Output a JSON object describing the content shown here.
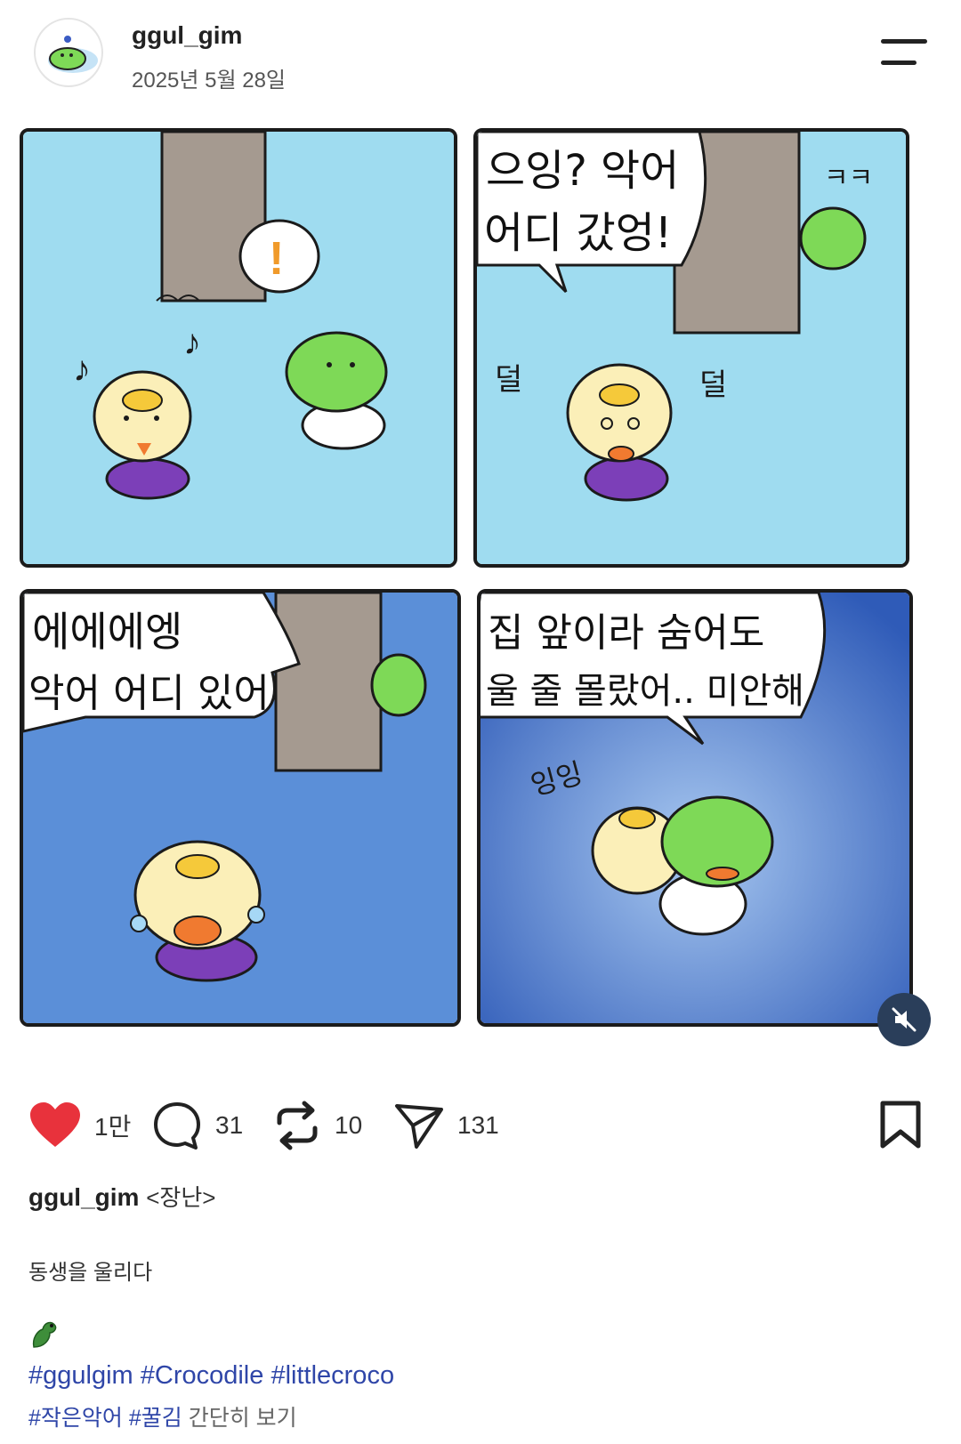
{
  "header": {
    "username": "ggul_gim",
    "date": "2025년 5월 28일"
  },
  "comic": {
    "panel1": {
      "bubble": "!"
    },
    "panel2": {
      "bubble_line1": "으잉? 악어",
      "bubble_line2": "어디 갔엉!",
      "sfx_giggle": "ㅋㅋ",
      "sfx_left": "덜",
      "sfx_right": "덜"
    },
    "panel3": {
      "bubble_line1": "에에에엥",
      "bubble_line2": "악어 어디 있어"
    },
    "panel4": {
      "bubble_line1": "집 앞이라 숨어도",
      "bubble_line2": "울 줄 몰랐어.. 미안해",
      "sfx": "잉잉"
    }
  },
  "actions": {
    "likes": "1만",
    "comments": "31",
    "reposts": "10",
    "shares": "131"
  },
  "post": {
    "author": "ggul_gim",
    "title": "<장난>",
    "description": "동생을 울리다",
    "tags_line1": [
      "#ggulgim",
      "#Crocodile",
      "#littlecroco"
    ],
    "tags_line2": [
      "#작은악어",
      "#꿀김"
    ],
    "more_label": "간단히 보기"
  },
  "colors": {
    "sky": "#9fdcf0",
    "dark_blue": "#4a7fd0",
    "croc_green": "#7ed957",
    "bunny_cream": "#fbefb8",
    "shirt_purple": "#7c3fb8",
    "heart_red": "#e8323c",
    "tag_blue": "#2f46a8"
  },
  "icons": [
    "menu-icon",
    "heart-icon",
    "comment-icon",
    "repost-icon",
    "share-icon",
    "bookmark-icon",
    "mute-icon",
    "crocodile-emoji-icon"
  ]
}
